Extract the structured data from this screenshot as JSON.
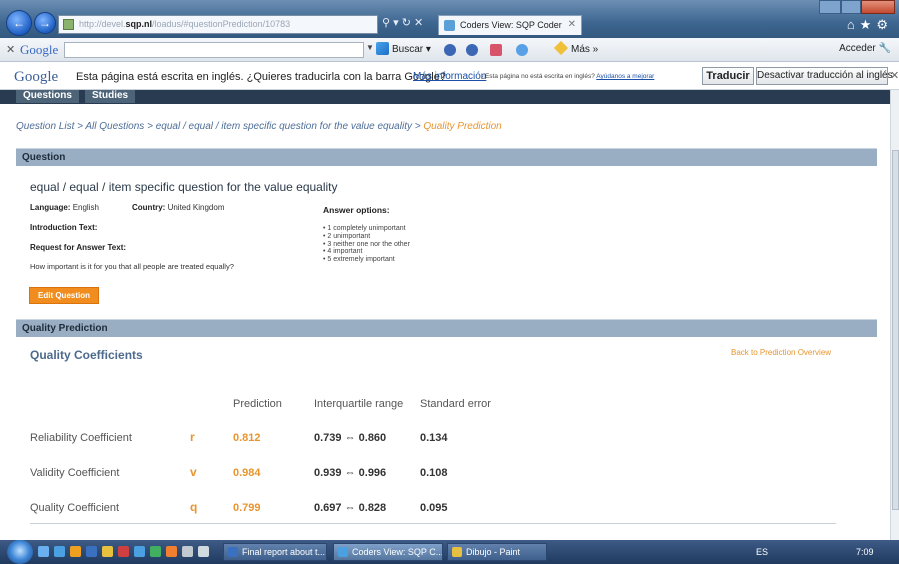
{
  "browser": {
    "url_prefix": "http://devel.",
    "url_host": "sqp.nl",
    "url_rest": "/loadus/#questionPrediction/10783",
    "tab_title": "Coders View: SQP Coder"
  },
  "google_toolbar": {
    "logo": "Google",
    "buscar_label": "Buscar",
    "mas_label": "Más »",
    "acceder_label": "Acceder"
  },
  "translate_bar": {
    "logo": "Google",
    "message": "Esta página está escrita en inglés. ¿Quieres traducirla con la barra Google?",
    "more_info": "Más información",
    "small_text": "¿Esta página no está escrita en inglés?",
    "small_link": "Ayúdanos a mejorar",
    "translate_button": "Traducir",
    "disable_button": "Desactivar traducción al inglés"
  },
  "nav": {
    "tabs": [
      {
        "label": "Questions"
      },
      {
        "label": "Studies"
      }
    ]
  },
  "breadcrumb": {
    "path": "Question List > All Questions > equal / equal / item specific question for the value equality > ",
    "current": "Quality Prediction"
  },
  "question": {
    "header": "Question",
    "title": "equal / equal / item specific question for the value equality",
    "language_label": "Language:",
    "language": "English",
    "country_label": "Country:",
    "country": "United Kingdom",
    "intro_label": "Introduction Text:",
    "request_label": "Request for Answer Text:",
    "request_text": "How important is it for you that all people are treated equally?",
    "answer_label": "Answer options:",
    "answers": [
      "1 completely unimportant",
      "2 unimportant",
      "3 neither one nor the other",
      "4 important",
      "5 extremely important"
    ],
    "edit_button": "Edit Question"
  },
  "quality_prediction": {
    "header": "Quality Prediction",
    "title": "Quality Coefficients",
    "back_link": "Back to Prediction Overview",
    "columns": [
      "Prediction",
      "Interquartile range",
      "Standard error"
    ],
    "rows": [
      {
        "label": "Reliability Coefficient",
        "symbol": "r",
        "prediction": "0.812",
        "iqr": "0.739 ⇔ 0.860",
        "se": "0.134"
      },
      {
        "label": "Validity Coefficient",
        "symbol": "v",
        "prediction": "0.984",
        "iqr": "0.939 ⇔ 0.996",
        "se": "0.108"
      },
      {
        "label": "Quality Coefficient",
        "symbol": "q",
        "prediction": "0.799",
        "iqr": "0.697 ⇔ 0.828",
        "se": "0.095"
      }
    ]
  },
  "taskbar": {
    "tasks": [
      {
        "label": "Final report about t..."
      },
      {
        "label": "Coders View: SQP C..."
      },
      {
        "label": "Dibujo - Paint"
      }
    ],
    "lang": "ES",
    "clock": "7:09"
  },
  "colors": {
    "accent_orange": "#e8952e",
    "section_header": "#99aec2",
    "nav_dark": "#283b50"
  }
}
